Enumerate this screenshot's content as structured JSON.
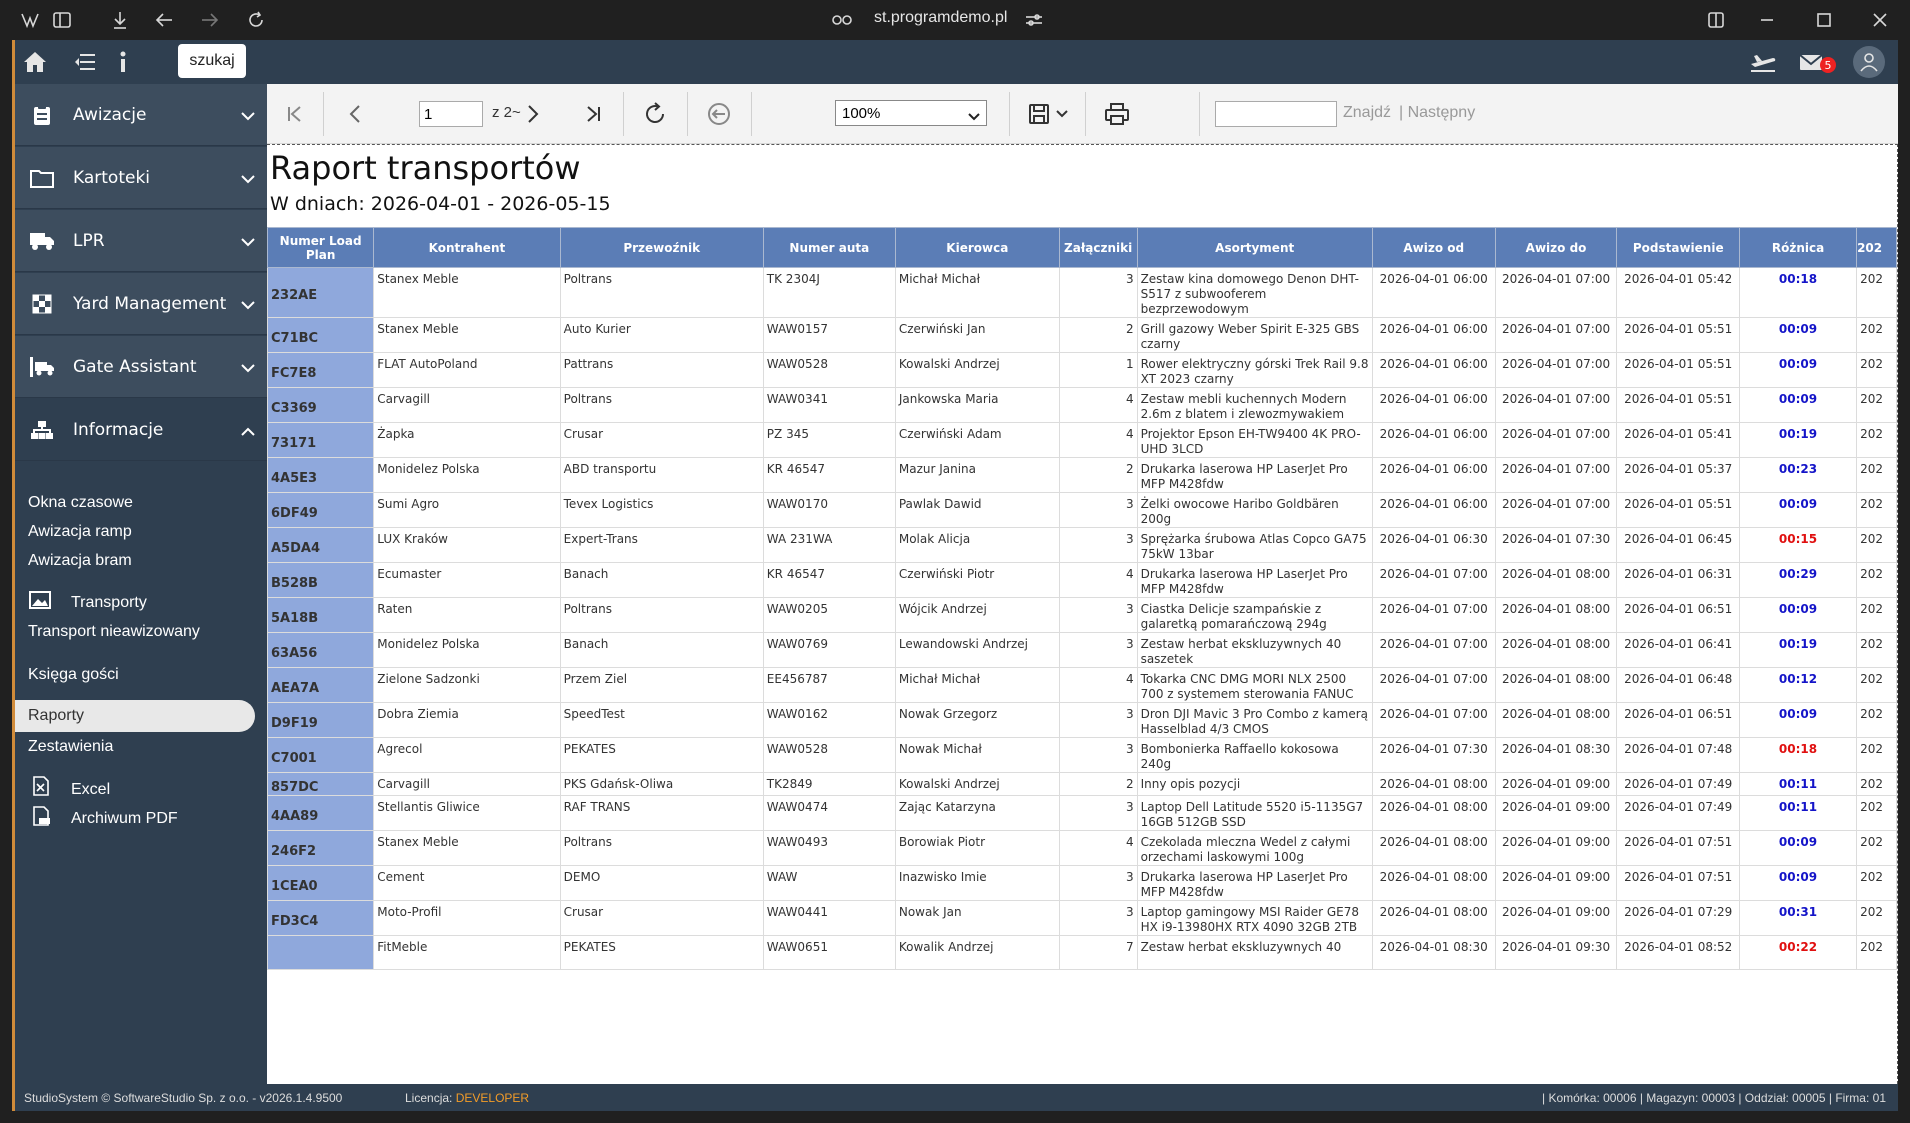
{
  "browser": {
    "url": "st.programdemo.pl"
  },
  "topbar": {
    "search_label": "szukaj",
    "mail_count": "5"
  },
  "sidebar": {
    "sections": [
      {
        "label": "Awizacje"
      },
      {
        "label": "Kartoteki"
      },
      {
        "label": "LPR"
      },
      {
        "label": "Yard Management"
      },
      {
        "label": "Gate Assistant"
      },
      {
        "label": "Informacje"
      }
    ],
    "subitems": [
      {
        "label": "Okna czasowe"
      },
      {
        "label": "Awizacja ramp"
      },
      {
        "label": "Awizacja bram"
      },
      {
        "label": "Transporty"
      },
      {
        "label": "Transport nieawizowany"
      },
      {
        "label": "Księga gości"
      },
      {
        "label": "Raporty"
      },
      {
        "label": "Zestawienia"
      },
      {
        "label": "Excel"
      },
      {
        "label": "Archiwum PDF"
      }
    ]
  },
  "toolbar": {
    "page_value": "1",
    "page_of": "z 2~",
    "zoom_value": "100%",
    "find_label": "Znajdź",
    "next_label": "| Następny"
  },
  "report": {
    "title": "Raport transportów",
    "subtitle": "W dniach: 2026-04-01 - 2026-05-15",
    "columns": [
      "Numer Load Plan",
      "Kontrahent",
      "Przewoźnik",
      "Numer auta",
      "Kierowca",
      "Załączniki",
      "Asortyment",
      "Awizo od",
      "Awizo do",
      "Podstawienie",
      "Różnica",
      "202"
    ],
    "rows": [
      {
        "id": "232AE",
        "kontrahent": "Stanex Meble",
        "przewoznik": "Poltrans",
        "auto": "TK 2304J",
        "kierowca": "Michał Michał",
        "zal": "3",
        "asort": "Zestaw kina domowego Denon DHT-S517 z subwooferem bezprzewodowym",
        "od": "2026-04-01 06:00",
        "do": "2026-04-01 07:00",
        "podst": "2026-04-01 05:42",
        "diff": "00:18",
        "color": "blue",
        "extra": "202"
      },
      {
        "id": "C71BC",
        "kontrahent": "Stanex Meble",
        "przewoznik": "Auto Kurier",
        "auto": "WAW0157",
        "kierowca": "Czerwiński Jan",
        "zal": "2",
        "asort": "Grill gazowy Weber Spirit E-325 GBS czarny",
        "od": "2026-04-01 06:00",
        "do": "2026-04-01 07:00",
        "podst": "2026-04-01 05:51",
        "diff": "00:09",
        "color": "blue",
        "extra": "202"
      },
      {
        "id": "FC7E8",
        "kontrahent": "FLAT AutoPoland",
        "przewoznik": "Pattrans",
        "auto": "WAW0528",
        "kierowca": "Kowalski Andrzej",
        "zal": "1",
        "asort": "Rower elektryczny górski Trek Rail 9.8 XT 2023 czarny",
        "od": "2026-04-01 06:00",
        "do": "2026-04-01 07:00",
        "podst": "2026-04-01 05:51",
        "diff": "00:09",
        "color": "blue",
        "extra": "202"
      },
      {
        "id": "C3369",
        "kontrahent": "Carvagill",
        "przewoznik": "Poltrans",
        "auto": "WAW0341",
        "kierowca": "Jankowska Maria",
        "zal": "4",
        "asort": "Zestaw mebli kuchennych Modern 2.6m z blatem i zlewozmywakiem",
        "od": "2026-04-01 06:00",
        "do": "2026-04-01 07:00",
        "podst": "2026-04-01 05:51",
        "diff": "00:09",
        "color": "blue",
        "extra": "202"
      },
      {
        "id": "73171",
        "kontrahent": "Żapka",
        "przewoznik": "Crusar",
        "auto": "PZ 345",
        "kierowca": "Czerwiński Adam",
        "zal": "4",
        "asort": "Projektor Epson EH-TW9400 4K PRO-UHD 3LCD",
        "od": "2026-04-01 06:00",
        "do": "2026-04-01 07:00",
        "podst": "2026-04-01 05:41",
        "diff": "00:19",
        "color": "blue",
        "extra": "202"
      },
      {
        "id": "4A5E3",
        "kontrahent": "Monidelez Polska",
        "przewoznik": "ABD transportu",
        "auto": "KR 46547",
        "kierowca": "Mazur Janina",
        "zal": "2",
        "asort": "Drukarka laserowa HP LaserJet Pro MFP M428fdw",
        "od": "2026-04-01 06:00",
        "do": "2026-04-01 07:00",
        "podst": "2026-04-01 05:37",
        "diff": "00:23",
        "color": "blue",
        "extra": "202"
      },
      {
        "id": "6DF49",
        "kontrahent": "Sumi Agro",
        "przewoznik": "Tevex Logistics",
        "auto": "WAW0170",
        "kierowca": "Pawlak Dawid",
        "zal": "3",
        "asort": "Żelki owocowe Haribo Goldbären 200g",
        "od": "2026-04-01 06:00",
        "do": "2026-04-01 07:00",
        "podst": "2026-04-01 05:51",
        "diff": "00:09",
        "color": "blue",
        "extra": "202"
      },
      {
        "id": "A5DA4",
        "kontrahent": "LUX Kraków",
        "przewoznik": "Expert-Trans",
        "auto": "WA 231WA",
        "kierowca": "Molak Alicja",
        "zal": "3",
        "asort": "Sprężarka śrubowa Atlas Copco GA75 75kW 13bar",
        "od": "2026-04-01 06:30",
        "do": "2026-04-01 07:30",
        "podst": "2026-04-01 06:45",
        "diff": "00:15",
        "color": "red",
        "extra": "202"
      },
      {
        "id": "B528B",
        "kontrahent": "Ecumaster",
        "przewoznik": "Banach",
        "auto": "KR 46547",
        "kierowca": "Czerwiński Piotr",
        "zal": "4",
        "asort": "Drukarka laserowa HP LaserJet Pro MFP M428fdw",
        "od": "2026-04-01 07:00",
        "do": "2026-04-01 08:00",
        "podst": "2026-04-01 06:31",
        "diff": "00:29",
        "color": "blue",
        "extra": "202"
      },
      {
        "id": "5A18B",
        "kontrahent": "Raten",
        "przewoznik": "Poltrans",
        "auto": "WAW0205",
        "kierowca": "Wójcik Andrzej",
        "zal": "3",
        "asort": "Ciastka Delicje szampańskie z galaretką pomarańczową 294g",
        "od": "2026-04-01 07:00",
        "do": "2026-04-01 08:00",
        "podst": "2026-04-01 06:51",
        "diff": "00:09",
        "color": "blue",
        "extra": "202"
      },
      {
        "id": "63A56",
        "kontrahent": "Monidelez Polska",
        "przewoznik": "Banach",
        "auto": "WAW0769",
        "kierowca": "Lewandowski Andrzej",
        "zal": "3",
        "asort": "Zestaw herbat ekskluzywnych 40 saszetek",
        "od": "2026-04-01 07:00",
        "do": "2026-04-01 08:00",
        "podst": "2026-04-01 06:41",
        "diff": "00:19",
        "color": "blue",
        "extra": "202"
      },
      {
        "id": "AEA7A",
        "kontrahent": "Zielone Sadzonki",
        "przewoznik": "Przem Ziel",
        "auto": "EE456787",
        "kierowca": "Michał Michał",
        "zal": "4",
        "asort": "Tokarka CNC DMG MORI NLX 2500 700 z systemem sterowania FANUC",
        "od": "2026-04-01 07:00",
        "do": "2026-04-01 08:00",
        "podst": "2026-04-01 06:48",
        "diff": "00:12",
        "color": "blue",
        "extra": "202"
      },
      {
        "id": "D9F19",
        "kontrahent": "Dobra Ziemia",
        "przewoznik": "SpeedTest",
        "auto": "WAW0162",
        "kierowca": "Nowak Grzegorz",
        "zal": "3",
        "asort": "Dron DJI Mavic 3 Pro Combo z kamerą Hasselblad 4/3 CMOS",
        "od": "2026-04-01 07:00",
        "do": "2026-04-01 08:00",
        "podst": "2026-04-01 06:51",
        "diff": "00:09",
        "color": "blue",
        "extra": "202"
      },
      {
        "id": "C7001",
        "kontrahent": "Agrecol",
        "przewoznik": "PEKATES",
        "auto": "WAW0528",
        "kierowca": "Nowak Michał",
        "zal": "3",
        "asort": "Bombonierka Raffaello kokosowa 240g",
        "od": "2026-04-01 07:30",
        "do": "2026-04-01 08:30",
        "podst": "2026-04-01 07:48",
        "diff": "00:18",
        "color": "red",
        "extra": "202"
      },
      {
        "id": "857DC",
        "kontrahent": "Carvagill",
        "przewoznik": "PKS Gdańsk-Oliwa",
        "auto": "TK2849",
        "kierowca": "Kowalski Andrzej",
        "zal": "2",
        "asort": "Inny opis pozycji",
        "od": "2026-04-01 08:00",
        "do": "2026-04-01 09:00",
        "podst": "2026-04-01 07:49",
        "diff": "00:11",
        "color": "blue",
        "extra": "202"
      },
      {
        "id": "4AA89",
        "kontrahent": "Stellantis Gliwice",
        "przewoznik": "RAF TRANS",
        "auto": "WAW0474",
        "kierowca": "Zając Katarzyna",
        "zal": "3",
        "asort": "Laptop Dell Latitude 5520 i5-1135G7 16GB 512GB SSD",
        "od": "2026-04-01 08:00",
        "do": "2026-04-01 09:00",
        "podst": "2026-04-01 07:49",
        "diff": "00:11",
        "color": "blue",
        "extra": "202"
      },
      {
        "id": "246F2",
        "kontrahent": "Stanex Meble",
        "przewoznik": "Poltrans",
        "auto": "WAW0493",
        "kierowca": "Borowiak Piotr",
        "zal": "4",
        "asort": "Czekolada mleczna Wedel z całymi orzechami laskowymi 100g",
        "od": "2026-04-01 08:00",
        "do": "2026-04-01 09:00",
        "podst": "2026-04-01 07:51",
        "diff": "00:09",
        "color": "blue",
        "extra": "202"
      },
      {
        "id": "1CEA0",
        "kontrahent": "Cement",
        "przewoznik": "DEMO",
        "auto": "WAW",
        "kierowca": "Inazwisko Imie",
        "zal": "3",
        "asort": "Drukarka laserowa HP LaserJet Pro MFP M428fdw",
        "od": "2026-04-01 08:00",
        "do": "2026-04-01 09:00",
        "podst": "2026-04-01 07:51",
        "diff": "00:09",
        "color": "blue",
        "extra": "202"
      },
      {
        "id": "FD3C4",
        "kontrahent": "Moto-Profil",
        "przewoznik": "Crusar",
        "auto": "WAW0441",
        "kierowca": "Nowak Jan",
        "zal": "3",
        "asort": "Laptop gamingowy MSI Raider GE78 HX i9-13980HX RTX 4090 32GB 2TB",
        "od": "2026-04-01 08:00",
        "do": "2026-04-01 09:00",
        "podst": "2026-04-01 07:29",
        "diff": "00:31",
        "color": "blue",
        "extra": "202"
      },
      {
        "id": "",
        "kontrahent": "FitMeble",
        "przewoznik": "PEKATES",
        "auto": "WAW0651",
        "kierowca": "Kowalik Andrzej",
        "zal": "7",
        "asort": "Zestaw herbat ekskluzywnych 40",
        "od": "2026-04-01 08:30",
        "do": "2026-04-01 09:30",
        "podst": "2026-04-01 08:52",
        "diff": "00:22",
        "color": "red",
        "extra": "202"
      }
    ]
  },
  "status": {
    "left": "StudioSystem © SoftwareStudio Sp. z o.o. - v2026.1.4.9500",
    "license_label": "Licencja:",
    "license_value": "DEVELOPER",
    "right": "| Komórka: 00006 | Magazyn: 00003 | Oddział: 00005 | Firma: 01"
  }
}
